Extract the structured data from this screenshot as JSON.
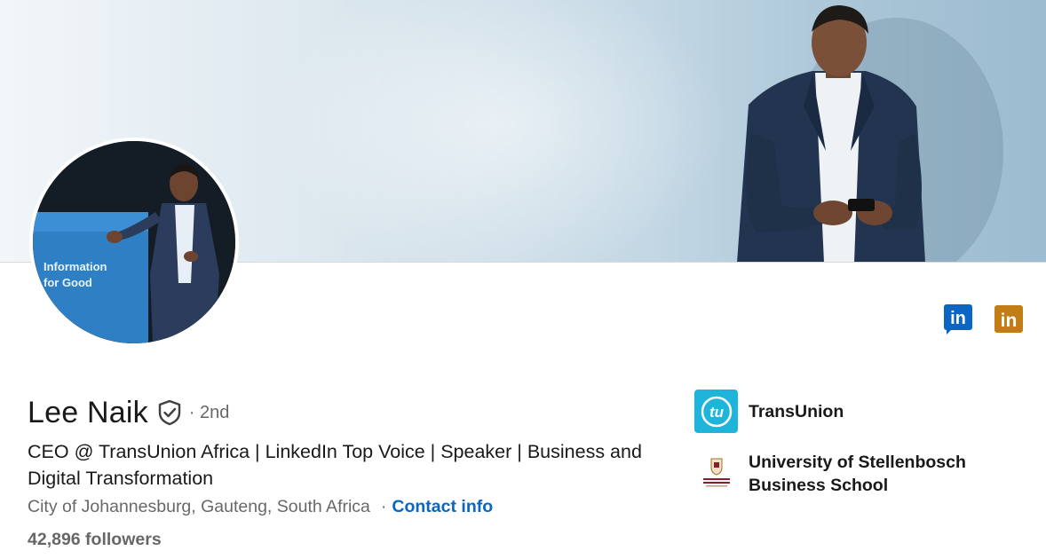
{
  "banner": {
    "icon": "banner-photo-man-with-phone"
  },
  "avatar": {
    "icon": "profile-photo",
    "sign_line1": "Information",
    "sign_line2": "for Good"
  },
  "top_icons": [
    {
      "icon": "linkedin-icon",
      "color": "#0a66c2",
      "text": "in"
    },
    {
      "icon": "linkedin-icon",
      "color": "#c37d16",
      "text": "in"
    }
  ],
  "profile": {
    "name": "Lee Naik",
    "degree": "· 2nd",
    "headline": "CEO @ TransUnion Africa | LinkedIn Top Voice | Speaker | Business and Digital Transformation",
    "location": "City of Johannesburg, Gauteng, South Africa",
    "separator": "·",
    "contact_label": "Contact info",
    "followers": "42,896 followers"
  },
  "companies": [
    {
      "name": "TransUnion",
      "logo_text": "tu",
      "logo_color": "#1fb4d9"
    },
    {
      "name_line1": "University of Stellenbosch",
      "name_line2": "Business School",
      "logo_color": "#8c1d2f"
    }
  ],
  "colors": {
    "link": "#0a66c2",
    "text": "#191919",
    "muted": "#666666"
  }
}
